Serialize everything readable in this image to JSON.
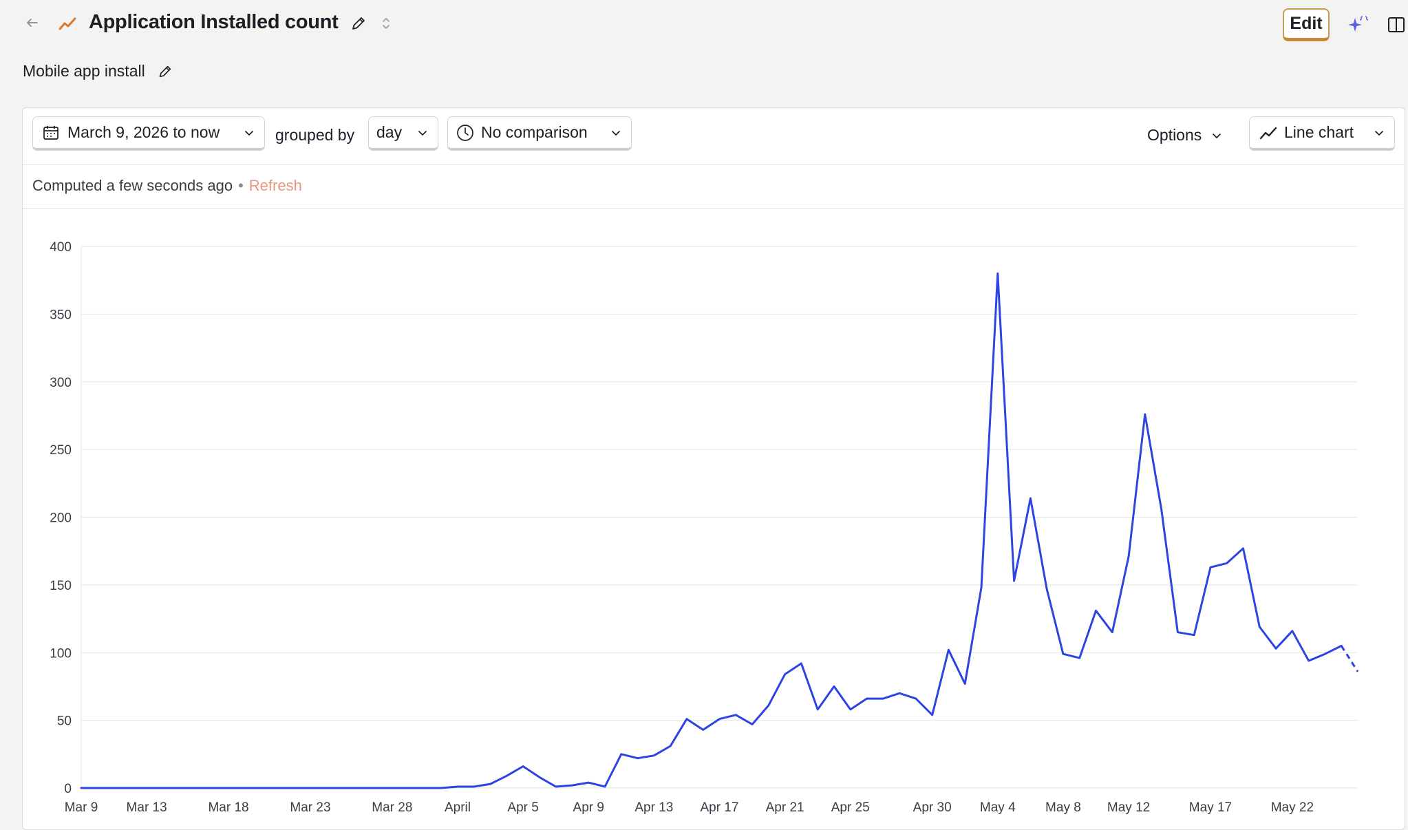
{
  "header": {
    "title": "Application Installed count",
    "subtitle": "Mobile app install",
    "edit_label": "Edit",
    "icons": {
      "back": "arrow-left-icon",
      "insight": "trend-line-icon",
      "rename": "pencil-icon",
      "expand": "expand-icon",
      "ai": "sparkle-ai-icon",
      "panel": "side-panel-icon"
    }
  },
  "toolbar": {
    "date_range": "March 9, 2026 to now",
    "grouped_by_label": "grouped by",
    "interval": "day",
    "comparison": "No comparison",
    "options_label": "Options",
    "chart_type": "Line chart"
  },
  "status": {
    "computed": "Computed a few seconds ago",
    "separator": "•",
    "refresh": "Refresh"
  },
  "colors": {
    "series": "#2d44e3",
    "accent": "#c99b52",
    "refresh": "#e8977a",
    "trend_icon": "#d97a2b"
  },
  "chart_data": {
    "type": "line",
    "x_tick_labels": [
      "Mar 9",
      "Mar 13",
      "Mar 18",
      "Mar 23",
      "Mar 28",
      "April",
      "Apr 5",
      "Apr 9",
      "Apr 13",
      "Apr 17",
      "Apr 21",
      "Apr 25",
      "Apr 30",
      "May 4",
      "May 8",
      "May 12",
      "May 17",
      "May 22"
    ],
    "x_tick_day_index": [
      0,
      4,
      9,
      14,
      19,
      23,
      27,
      31,
      35,
      39,
      43,
      47,
      52,
      56,
      60,
      64,
      69,
      74
    ],
    "ylim": [
      0,
      400
    ],
    "y_ticks": [
      0,
      50,
      100,
      150,
      200,
      250,
      300,
      350,
      400
    ],
    "grid": true,
    "start_date": "2026-03-09",
    "series": [
      {
        "values": [
          0,
          0,
          0,
          0,
          0,
          0,
          0,
          0,
          0,
          0,
          0,
          0,
          0,
          0,
          0,
          0,
          0,
          0,
          0,
          0,
          0,
          0,
          0,
          1,
          1,
          3,
          9,
          16,
          8,
          1,
          2,
          4,
          1,
          25,
          22,
          24,
          31,
          51,
          43,
          51,
          54,
          47,
          61,
          84,
          92,
          58,
          75,
          58,
          66,
          66,
          70,
          66,
          54,
          102,
          77,
          148,
          380,
          153,
          214,
          147,
          99,
          96,
          131,
          115,
          171,
          276,
          206,
          115,
          113,
          163,
          166,
          177,
          119,
          103,
          116,
          94,
          99,
          105,
          86
        ],
        "projected_from_index": 77
      }
    ]
  }
}
